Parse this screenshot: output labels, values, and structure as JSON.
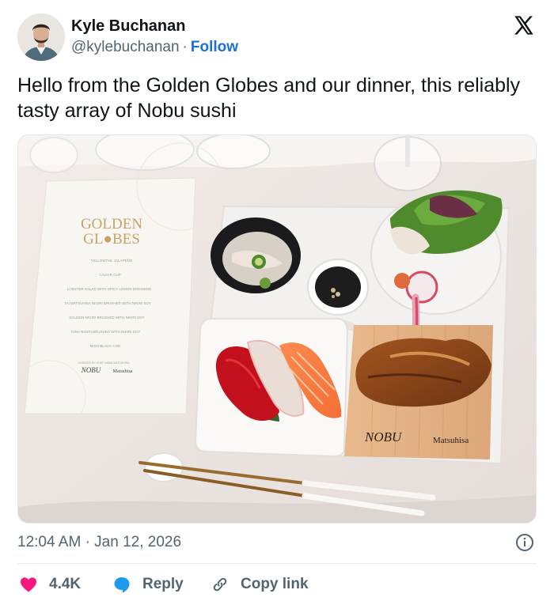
{
  "author": {
    "name": "Kyle Buchanan",
    "handle": "@kylebuchanan",
    "separator": "·",
    "follow_label": "Follow"
  },
  "tweet": {
    "text": "Hello from the Golden Globes and our dinner, this reliably tasty array of Nobu sushi"
  },
  "photo": {
    "menu": {
      "title_line1": "GOLDEN",
      "title_line2": "GL●BES",
      "items": [
        "YELLOWTAIL JALAPEÑO",
        "CAVIAR CUP",
        "LOBSTER SALAD WITH SPICY LEMON DRESSING",
        "TAI MATSUHISA NIGIRI BRUSHED WITH NIKIRI SOY",
        "SALMON NIGIRI BRUSHED WITH NIKIRI SOY",
        "TUNA NIGIRI BRUSHED WITH NIKIRI SOY",
        "MISO BLACK COD"
      ],
      "footer_small": "CURATED BY CHEF NOBU MATSUHISA",
      "footer_brand": "NOBU",
      "footer_brand2": "Matsuhisa"
    },
    "board": {
      "brand1": "NOBU",
      "brand2": "Matsuhisa"
    }
  },
  "meta": {
    "time": "12:04 AM",
    "separator": "·",
    "date": "Jan 12, 2026"
  },
  "actions": {
    "likes": "4.4K",
    "reply_label": "Reply",
    "copy_label": "Copy link"
  },
  "colors": {
    "like": "#f91880",
    "reply": "#1d9bf0",
    "follow": "#1d6fd6",
    "muted": "#536471"
  },
  "icons": [
    "x-logo-icon",
    "info-icon",
    "heart-icon",
    "reply-bubble-icon",
    "link-icon"
  ]
}
